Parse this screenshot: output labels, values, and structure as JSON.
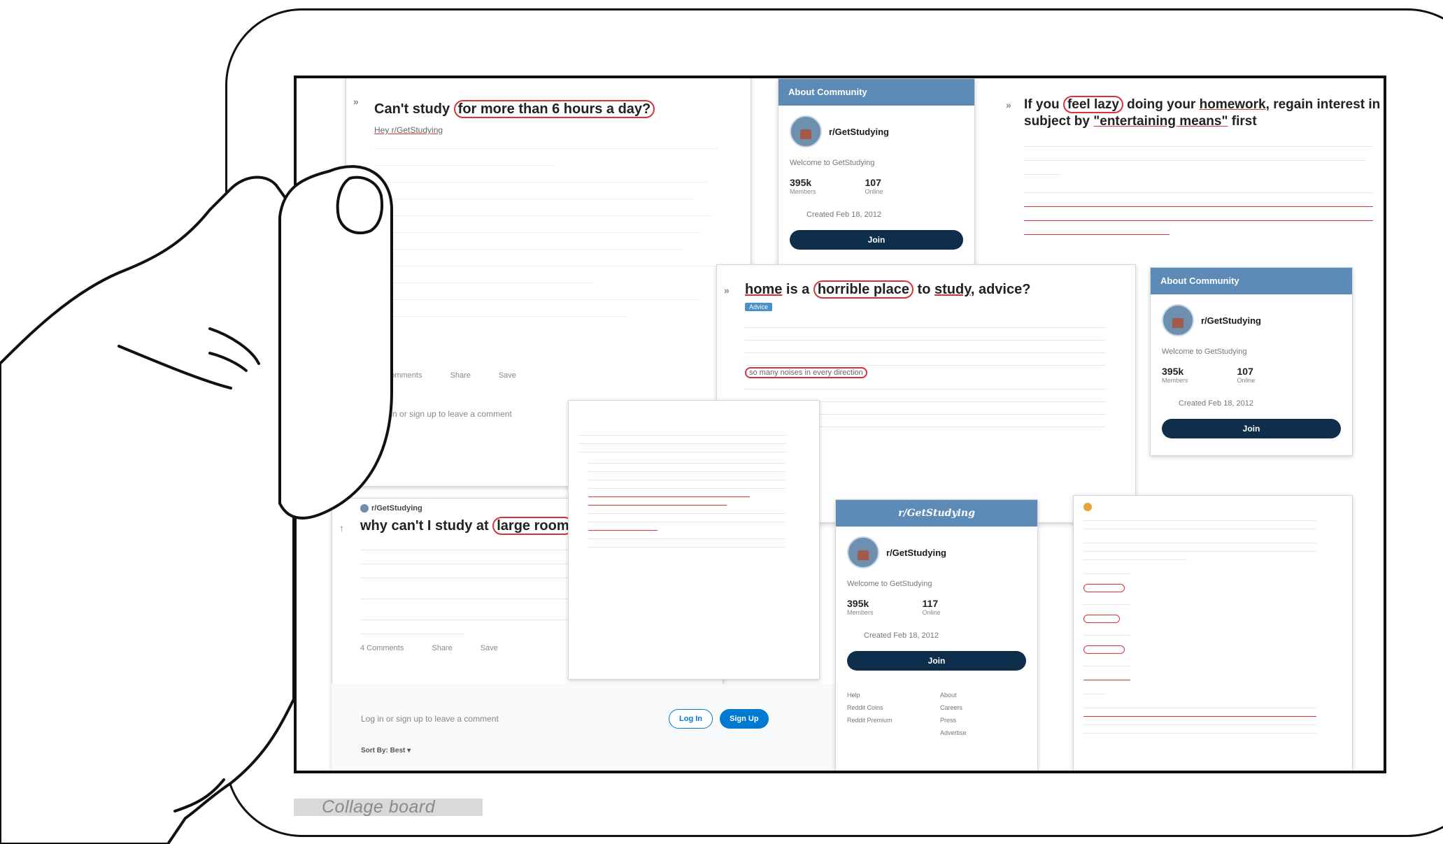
{
  "caption": "Collage board",
  "post1": {
    "title_pre": "Can't study ",
    "title_circled": "for more than 6 hours a day?",
    "subreddit_link": "Hey r/GetStudying",
    "comments": "22 Comments",
    "share": "Share",
    "save": "Save",
    "login_prompt": "Log in or sign up to leave a comment"
  },
  "post2": {
    "title_pre": "If you ",
    "title_circled": "feel lazy",
    "title_mid": " doing your ",
    "title_ul": "homework",
    "title_post": ", regain interest in th",
    "title_line2_pre": "subject by ",
    "title_line2_circled": "\"entertaining means\"",
    "title_line2_post": " first"
  },
  "post3": {
    "title_ul1": "home",
    "title_mid1": " is a ",
    "title_circled": "horrible place",
    "title_mid2": " to ",
    "title_ul2": "study",
    "title_post": ", advice?",
    "tag": "Advice",
    "body_ul": "so many noises in every direction"
  },
  "post4": {
    "sub": "r/GetStudying",
    "title_pre": "why can't I study at ",
    "title_circled": "large room",
    "comments": "4 Comments",
    "share": "Share",
    "save": "Save",
    "login_prompt": "Log in or sign up to leave a comment",
    "login_btn": "Log In",
    "signup_btn": "Sign Up",
    "sort": "Sort By: Best"
  },
  "about": [
    {
      "header": "About Community",
      "name": "r/GetStudying",
      "welcome": "Welcome to GetStudying",
      "members_val": "395k",
      "members_lbl": "Members",
      "online_val": "107",
      "online_lbl": "Online",
      "created": "Created Feb 18, 2012",
      "join": "Join"
    },
    {
      "header": "About Community",
      "name": "r/GetStudying",
      "welcome": "Welcome to GetStudying",
      "members_val": "395k",
      "members_lbl": "Members",
      "online_val": "107",
      "online_lbl": "Online",
      "created": "Created Feb 18, 2012",
      "join": "Join"
    },
    {
      "header": "r/GetStudying",
      "name": "r/GetStudying",
      "welcome": "Welcome to GetStudying",
      "members_val": "395k",
      "members_lbl": "Members",
      "online_val": "117",
      "online_lbl": "Online",
      "created": "Created Feb 18, 2012",
      "join": "Join"
    }
  ],
  "footer_links": [
    "Help",
    "About",
    "Reddit Coins",
    "Careers",
    "Reddit Premium",
    "Press",
    "Advertise"
  ]
}
